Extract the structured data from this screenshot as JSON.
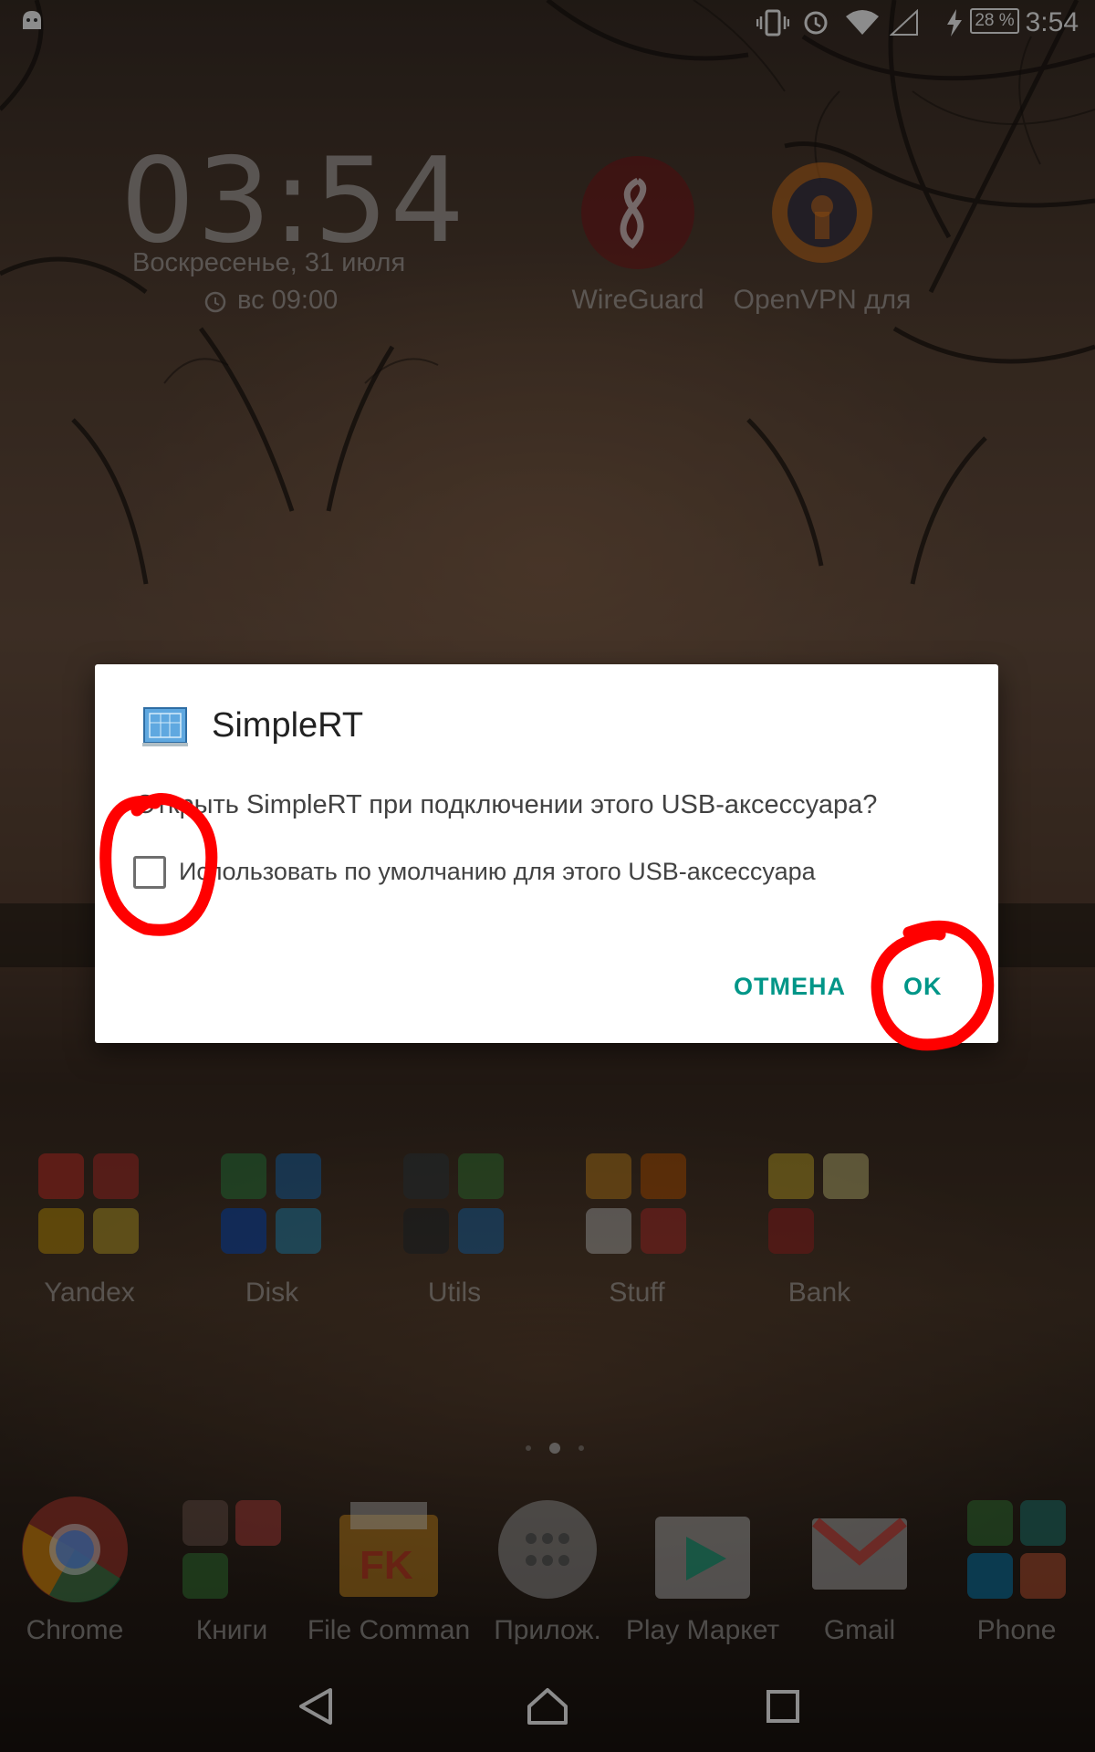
{
  "status_bar": {
    "time": "3:54",
    "battery": "28 %",
    "icons": [
      "android-debug-icon",
      "vibrate-icon",
      "alarm-icon",
      "wifi-icon",
      "cellular-signal-icon",
      "charging-icon",
      "battery-icon"
    ]
  },
  "clock_widget": {
    "time": "03:54",
    "date": "Воскресенье, 31 июля",
    "alarm": "вс 09:00"
  },
  "home_apps_top": [
    {
      "label": "WireGuard",
      "icon": "wireguard-icon",
      "color": "#88171a"
    },
    {
      "label": "OpenVPN для",
      "icon": "openvpn-icon",
      "color": "#ea7e20"
    }
  ],
  "folders": [
    {
      "label": "Yandex"
    },
    {
      "label": "Disk"
    },
    {
      "label": "Utils"
    },
    {
      "label": "Stuff"
    },
    {
      "label": "Bank"
    }
  ],
  "dock": [
    {
      "label": "Chrome",
      "icon": "chrome-icon"
    },
    {
      "label": "Книги",
      "icon": "books-folder-icon"
    },
    {
      "label": "File Comman",
      "icon": "file-commander-icon"
    },
    {
      "label": "Прилож.",
      "icon": "app-drawer-icon"
    },
    {
      "label": "Play Маркет",
      "icon": "play-store-icon"
    },
    {
      "label": "Gmail",
      "icon": "gmail-icon"
    },
    {
      "label": "Phone",
      "icon": "phone-folder-icon"
    }
  ],
  "dialog": {
    "title": "SimpleRT",
    "message": "Открыть SimpleRT при подключении этого USB-аксессуара?",
    "checkbox_label": "Использовать по умолчанию для этого USB-аксессуара",
    "checkbox_checked": false,
    "cancel_label": "ОТМЕНА",
    "ok_label": "OK",
    "accent_color": "#009688"
  },
  "annotation_color": "#ff0000"
}
